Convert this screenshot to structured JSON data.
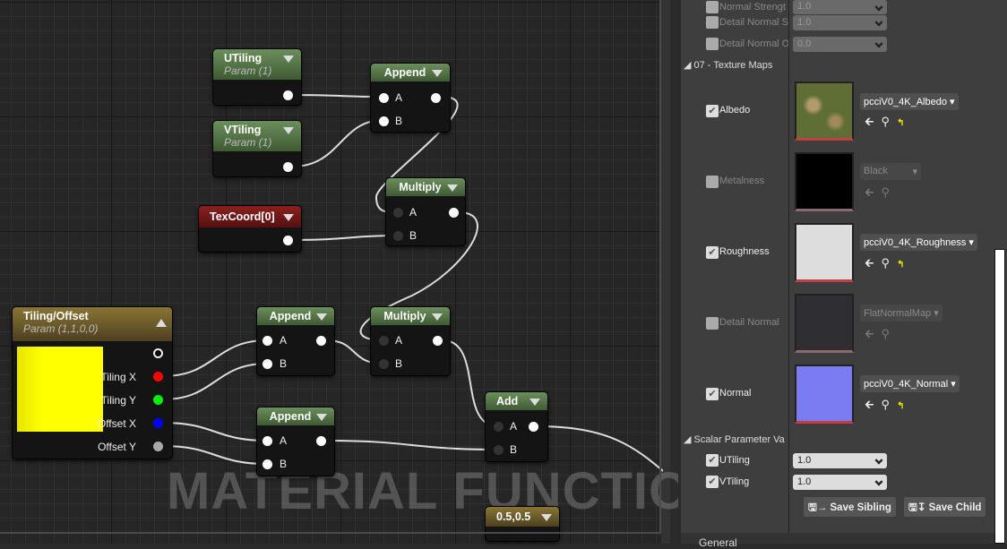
{
  "graph": {
    "watermark": "MATERIAL FUNCTION",
    "nodes": {
      "utiling": {
        "title": "UTiling",
        "sub": "Param (1)"
      },
      "vtiling": {
        "title": "VTiling",
        "sub": "Param (1)"
      },
      "append1": {
        "title": "Append",
        "a": "A",
        "b": "B"
      },
      "multiply1": {
        "title": "Multiply",
        "a": "A",
        "b": "B"
      },
      "texcoord": {
        "title": "TexCoord[0]"
      },
      "tiling_offset": {
        "title": "Tiling/Offset",
        "sub": "Param (1,1,0,0)",
        "swatch_color": "#ffff00",
        "pins": [
          "Tiling X",
          "Tiling Y",
          "Offset X",
          "Offset Y"
        ],
        "pin_colors": [
          "#ff0000",
          "#00e000",
          "#0000ff",
          "#aaaaaa"
        ]
      },
      "append2": {
        "title": "Append",
        "a": "A",
        "b": "B"
      },
      "multiply2": {
        "title": "Multiply",
        "a": "A",
        "b": "B"
      },
      "append3": {
        "title": "Append",
        "a": "A",
        "b": "B"
      },
      "add": {
        "title": "Add",
        "a": "A",
        "b": "B"
      },
      "const": {
        "title": "0.5,0.5"
      }
    }
  },
  "panel": {
    "top_rows": [
      {
        "label": "Normal Strengt",
        "value": "1.0"
      },
      {
        "label": "Detail Normal S",
        "value": "1.0"
      },
      {
        "label": "Detail Normal  O",
        "value": "0.0"
      }
    ],
    "texture_section": "07 - Texture Maps",
    "textures": [
      {
        "label": "Albedo",
        "checked": true,
        "asset": "pcciV0_4K_Albedo"
      },
      {
        "label": "Metalness",
        "checked": false,
        "asset": "Black"
      },
      {
        "label": "Roughness",
        "checked": true,
        "asset": "pcciV0_4K_Roughness"
      },
      {
        "label": "Detail Normal",
        "checked": false,
        "asset": "FlatNormalMap"
      },
      {
        "label": "Normal",
        "checked": true,
        "asset": "pcciV0_4K_Normal"
      }
    ],
    "scalar_section": "Scalar Parameter Va",
    "scalars": [
      {
        "label": "UTiling",
        "value": "1.0"
      },
      {
        "label": "VTiling",
        "value": "1.0"
      }
    ],
    "save_sibling": "Save Sibling",
    "save_child": "Save Child",
    "next_section": "General"
  }
}
